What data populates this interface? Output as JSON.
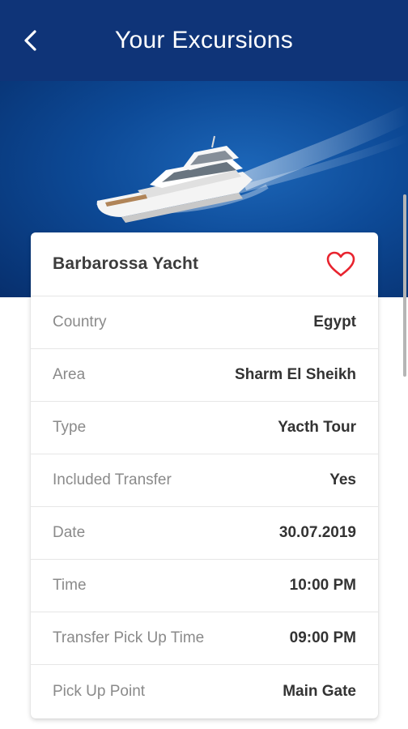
{
  "header": {
    "title": "Your Excursions",
    "back_icon": "chevron-left-icon"
  },
  "hero": {
    "image": "yacht-on-sea"
  },
  "excursion": {
    "name": "Barbarossa Yacht",
    "favorite_icon": "heart-outline-icon",
    "details": [
      {
        "label": "Country",
        "value": "Egypt"
      },
      {
        "label": "Area",
        "value": "Sharm El Sheikh"
      },
      {
        "label": "Type",
        "value": "Yacth Tour"
      },
      {
        "label": "Included Transfer",
        "value": "Yes"
      },
      {
        "label": "Date",
        "value": "30.07.2019"
      },
      {
        "label": "Time",
        "value": "10:00 PM"
      },
      {
        "label": "Transfer Pick Up Time",
        "value": "09:00 PM"
      },
      {
        "label": "Pick Up Point",
        "value": "Main Gate"
      }
    ]
  },
  "colors": {
    "app_bar": "#0f3478",
    "favorite": "#e8242f",
    "sea": "#0d4a97"
  }
}
